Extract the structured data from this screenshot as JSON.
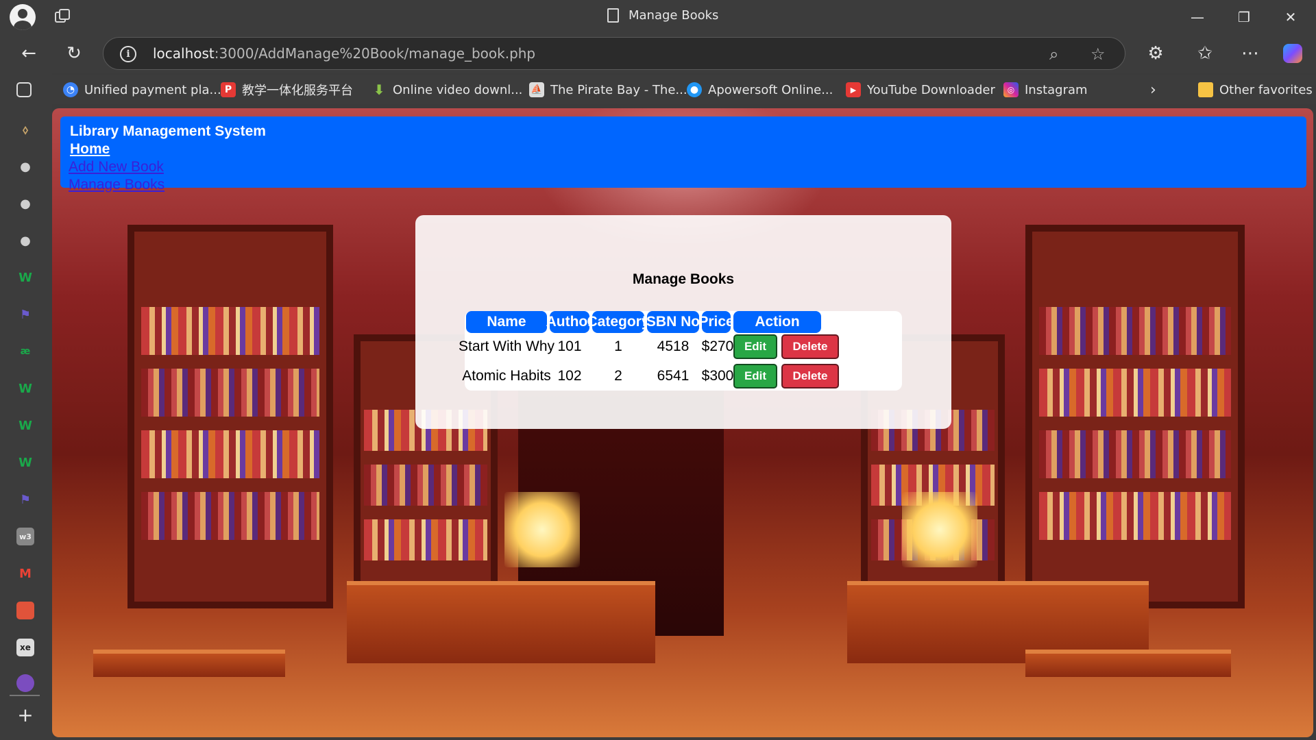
{
  "browser": {
    "tab_title": "Manage Books",
    "url_host": "localhost",
    "url_rest": ":3000/AddManage%20Book/manage_book.php",
    "favorites": [
      {
        "label": "Unified payment pla...",
        "icon": "payment-icon",
        "color": "#3b82f6"
      },
      {
        "label": "教学一体化服务平台",
        "icon": "p-logo-icon",
        "color": "#e53935"
      },
      {
        "label": "Online video downl...",
        "icon": "download-arrow-icon",
        "color": "#8bc34a"
      },
      {
        "label": "The Pirate Bay - The...",
        "icon": "pirate-ship-icon",
        "color": "#dddddd"
      },
      {
        "label": "Apowersoft Online...",
        "icon": "apowersoft-icon",
        "color": "#2196f3"
      },
      {
        "label": "YouTube Downloader",
        "icon": "youtube-icon",
        "color": "#e53935"
      },
      {
        "label": "Instagram",
        "icon": "instagram-icon",
        "color": "#d6249f"
      }
    ],
    "other_favorites": "Other favorites"
  },
  "page": {
    "brand": "Library Management System",
    "nav": {
      "home": "Home",
      "add_new_book": "Add New Book",
      "manage_books": "Manage Books"
    },
    "card_title": "Manage Books",
    "table": {
      "headers": [
        "Name",
        "Author",
        "Category",
        "ISBN No.",
        "Price",
        "Action"
      ],
      "rows": [
        {
          "name": "Start With Why",
          "author": "101",
          "category": "1",
          "isbn": "4518",
          "price": "$270",
          "edit": "Edit",
          "delete": "Delete"
        },
        {
          "name": "Atomic Habits",
          "author": "102",
          "category": "2",
          "isbn": "6541",
          "price": "$300",
          "edit": "Edit",
          "delete": "Delete"
        }
      ]
    },
    "colors": {
      "nav_bg": "#0066ff",
      "edit_btn": "#28a745",
      "delete_btn": "#dc3545"
    }
  }
}
